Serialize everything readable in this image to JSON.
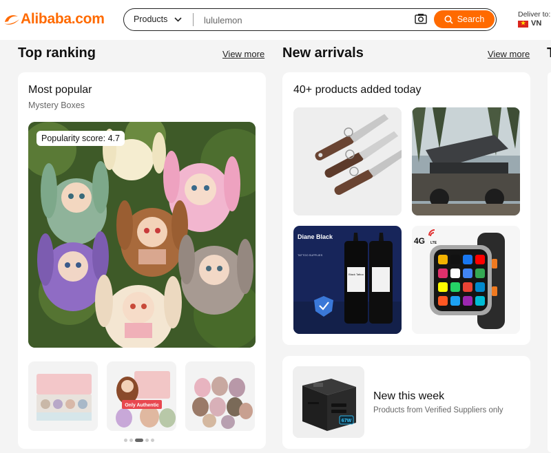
{
  "header": {
    "logo_text": "Alibaba.com",
    "category": "Products",
    "search_value": "lululemon",
    "search_button": "Search",
    "deliver_label": "Deliver to:",
    "deliver_country": "VN"
  },
  "top_ranking": {
    "title": "Top ranking",
    "view_more": "View more",
    "card_title": "Most popular",
    "card_subtitle": "Mystery Boxes",
    "badge_label": "Popularity score:",
    "badge_value": "4.7",
    "thumb_sticker": "Only Authentic"
  },
  "new_arrivals": {
    "title": "New arrivals",
    "view_more": "View more",
    "card_title": "40+ products added today",
    "ink_brand": "Diane Black",
    "ink_line": "TATTOO SUPPLIES",
    "ink_label": "Black Tattoo",
    "watch_badge": "4G",
    "watch_lte": "LTE",
    "new_week_title": "New this week",
    "new_week_subtitle": "Products from Verified Suppliers only",
    "charger_label": "67W"
  },
  "colors": {
    "accent": "#ff6a00",
    "background": "#f4f4f4"
  },
  "icons": [
    "chevron-down-icon",
    "camera-icon",
    "search-icon",
    "flag-vn-icon"
  ]
}
